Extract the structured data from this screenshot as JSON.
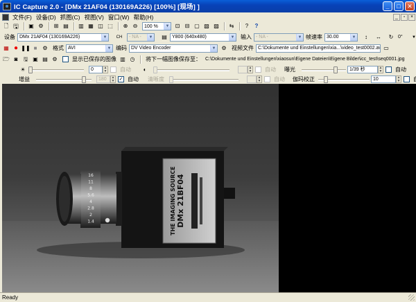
{
  "window": {
    "title": "IC Capture 2.0 - [DMx 21AF04 (130169A226) [100%] [现场] ]"
  },
  "menu": [
    "文件(F)",
    "设备(D)",
    "抓图(C)",
    "视图(V)",
    "窗口(W)",
    "帮助(H)"
  ],
  "toolbar1": {
    "zoom_value": "100 %"
  },
  "device_row": {
    "device_label": "设备",
    "device_value": "DMx 21AF04 (130169A226)",
    "na1": "- NA -",
    "format_value": "Y800 (640x480)",
    "input_label": "输入",
    "na2": "- NA -",
    "fps_label": "帧速率",
    "fps_value": "30.00",
    "rotation_value": "0°"
  },
  "record_row": {
    "format_label": "格式",
    "format_value": "AVI",
    "codec_label": "编码",
    "codec_value": "DV Video Encoder",
    "video_file_label": "视频文件",
    "video_file_path": "C:\\Dokumente und Einstellungen\\xia...\\video_test0002.avi"
  },
  "image_row": {
    "show_saved_label": "显示已保存的图像",
    "next_save_label": "将下一幅图像保存至：",
    "next_save_path": "C:\\Dokumente und Einstellungen\\xiaosun\\Eigene Dateien\\Eigene Bilder\\icc_test\\seq0001.jpg"
  },
  "props_row1": {
    "brightness_value": "0",
    "brightness_auto": "自动",
    "contrast_auto": "自动",
    "exposure_label": "曝光",
    "exposure_value": "1/39 秒",
    "exposure_auto": "自动"
  },
  "props_row2": {
    "gain_label": "增益",
    "gain_value": "180",
    "gain_auto": "自动",
    "sharpness_label": "清晰度",
    "sharpness_auto": "自动",
    "gamma_label": "伽玛校正",
    "gamma_value": "10",
    "gamma_auto": "自动"
  },
  "camera": {
    "brand": "THE IMAGING SOURCE",
    "model": "DMx 21BF04",
    "lens_marks": [
      "16",
      "11",
      "8",
      "5.6",
      "4",
      "2.8",
      "2",
      "1.4"
    ]
  },
  "status": {
    "text": "Ready"
  }
}
